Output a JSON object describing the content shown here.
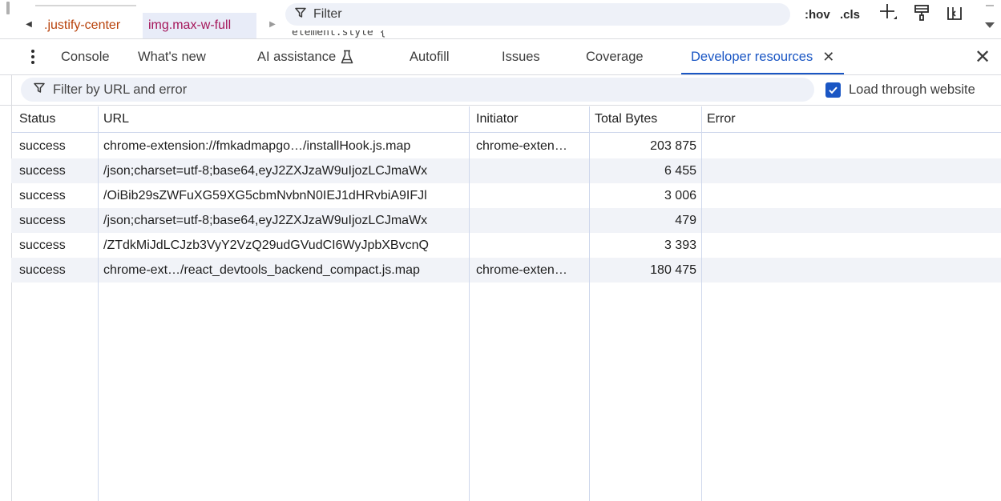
{
  "elements_strip": {
    "breadcrumbs": [
      ".justify-center",
      "img.max-w-full"
    ],
    "styles_filter_placeholder": "Filter",
    "element_style_peek": "element.style {",
    "hov_label": ":hov",
    "cls_label": ".cls"
  },
  "drawer": {
    "tabs": [
      {
        "label": "Console"
      },
      {
        "label": "What's new"
      },
      {
        "label": "AI assistance"
      },
      {
        "label": "Autofill"
      },
      {
        "label": "Issues"
      },
      {
        "label": "Coverage"
      },
      {
        "label": "Developer resources",
        "active": true
      }
    ]
  },
  "filter": {
    "placeholder": "Filter by URL and error",
    "load_through_label": "Load through website",
    "load_through_checked": true
  },
  "table": {
    "columns": [
      "Status",
      "URL",
      "Initiator",
      "Total Bytes",
      "Error"
    ],
    "rows": [
      {
        "status": "success",
        "url": "chrome-extension://fmkadmapgo…/installHook.js.map",
        "initiator": "chrome-exten…",
        "bytes": "203 875",
        "error": ""
      },
      {
        "status": "success",
        "url": "/json;charset=utf-8;base64,eyJ2ZXJzaW9uIjozLCJmaWx",
        "initiator": "",
        "bytes": "6 455",
        "error": ""
      },
      {
        "status": "success",
        "url": "/OiBib29sZWFuXG59XG5cbmNvbnN0IEJ1dHRvbiA9IFJl",
        "initiator": "",
        "bytes": "3 006",
        "error": ""
      },
      {
        "status": "success",
        "url": "/json;charset=utf-8;base64,eyJ2ZXJzaW9uIjozLCJmaWx",
        "initiator": "",
        "bytes": "479",
        "error": ""
      },
      {
        "status": "success",
        "url": "/ZTdkMiJdLCJzb3VyY2VzQ29udGVudCI6WyJpbXBvcnQ",
        "initiator": "",
        "bytes": "3 393",
        "error": ""
      },
      {
        "status": "success",
        "url": "chrome-ext…/react_devtools_backend_compact.js.map",
        "initiator": "chrome-exten…",
        "bytes": "180 475",
        "error": ""
      }
    ]
  },
  "colors": {
    "accent": "#1a56c4",
    "selector_tag": "#a5165a",
    "selector_class": "#b8420b",
    "row_alt": "#f1f3f8",
    "filter_bg": "#eef1f8"
  },
  "icons": [
    "filter-icon",
    "plus-icon",
    "paint-icon",
    "layout-icon",
    "more-vert-icon",
    "flask-icon",
    "close-icon",
    "checkbox-icon"
  ]
}
